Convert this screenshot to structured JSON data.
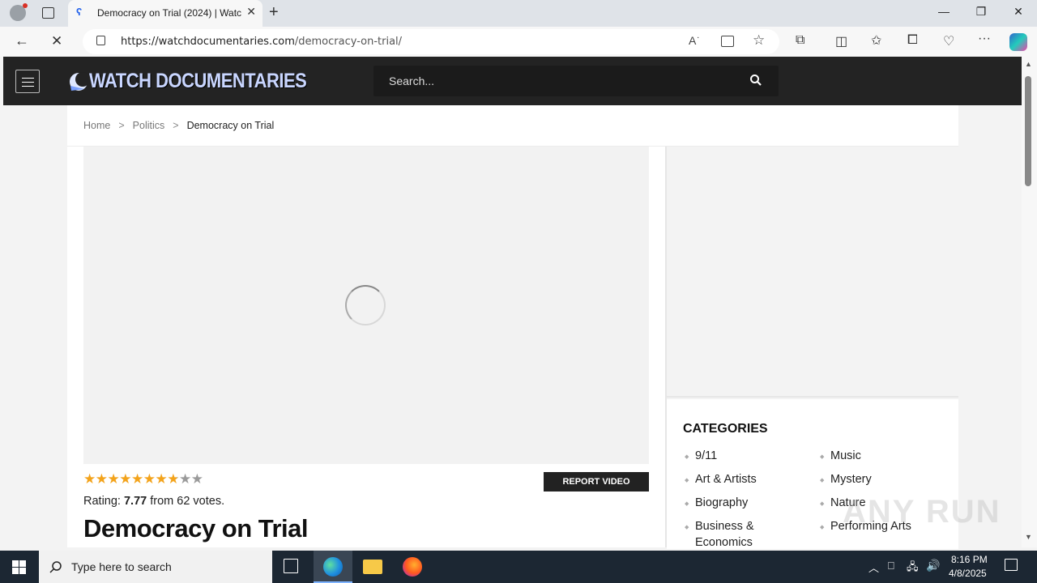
{
  "browser": {
    "tab_title": "Democracy on Trial (2024) | Watc",
    "url_host": "https://watchdocumentaries.com",
    "url_path": "/democracy-on-trial/"
  },
  "site": {
    "logo_text": "WATCH DOCUMENTARIES",
    "search_placeholder": "Search..."
  },
  "breadcrumb": {
    "home": "Home",
    "category": "Politics",
    "current": "Democracy on Trial",
    "separator": ">"
  },
  "video": {
    "report_label": "REPORT VIDEO",
    "rating_prefix": "Rating:",
    "rating_value": "7.77",
    "rating_suffix": "from 62 votes.",
    "stars_total": 10,
    "stars_filled": 7.77,
    "title": "Democracy on Trial"
  },
  "sidebar": {
    "categories_heading": "CATEGORIES",
    "col1": [
      "9/11",
      "Art & Artists",
      "Biography",
      "Business &",
      "Economics"
    ],
    "col2": [
      "Music",
      "Mystery",
      "Nature",
      "Performing Arts"
    ]
  },
  "taskbar": {
    "search_placeholder": "Type here to search",
    "time": "8:16 PM",
    "date": "4/8/2025"
  },
  "watermark": "ANY RUN"
}
